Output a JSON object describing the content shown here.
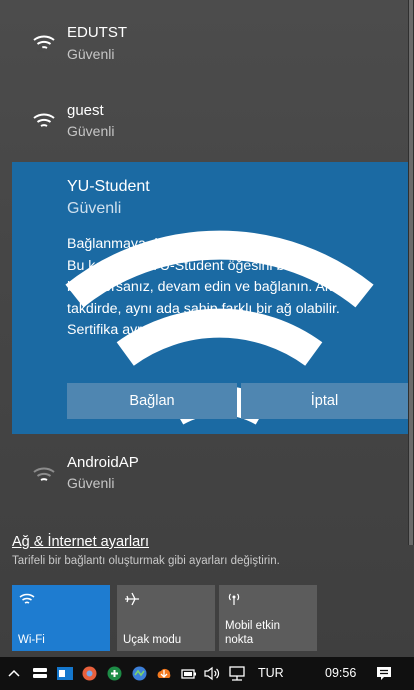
{
  "networks": [
    {
      "ssid": "EDUTST",
      "status": "Güvenli"
    },
    {
      "ssid": "guest",
      "status": "Güvenli"
    }
  ],
  "expanded_network": {
    "ssid": "YU-Student",
    "status": "Güvenli",
    "prompt_lines": [
      "Bağlanmaya devam edilsin mi?",
      "Bu konumda YU-Student öğesini bulmayı",
      "bekliyorsanız, devam edin ve bağlanın. Aksi",
      "takdirde, aynı ada sahip farklı bir ağ olabilir.",
      "Sertifika ayrıntılarını göster"
    ],
    "connect_label": "Bağlan",
    "cancel_label": "İptal"
  },
  "network_after": {
    "ssid": "AndroidAP",
    "status": "Güvenli"
  },
  "settings": {
    "link": "Ağ & İnternet ayarları",
    "description": "Tarifeli bir bağlantı oluşturmak gibi ayarları değiştirin."
  },
  "quick_actions": [
    {
      "label": "Wi-Fi",
      "icon": "wifi-icon",
      "active": true
    },
    {
      "label": "Uçak modu",
      "icon": "airplane-icon",
      "active": false
    },
    {
      "label": "Mobil etkin nokta",
      "label_lines": [
        "Mobil etkin",
        "nokta"
      ],
      "icon": "hotspot-icon",
      "active": false
    }
  ],
  "taskbar": {
    "language": "TUR",
    "time": "09:56",
    "icons": [
      "chevron-up-icon",
      "storage-icon",
      "outlook-icon",
      "ball-icon",
      "shield-icon",
      "app-icon",
      "cloud-icon",
      "battery-icon",
      "volume-icon",
      "network-icon",
      "notifications-icon"
    ]
  },
  "colors": {
    "accent": "#1e7cd0",
    "expanded_bg": "#1b6aa3",
    "button_bg": "#4f86b1"
  }
}
